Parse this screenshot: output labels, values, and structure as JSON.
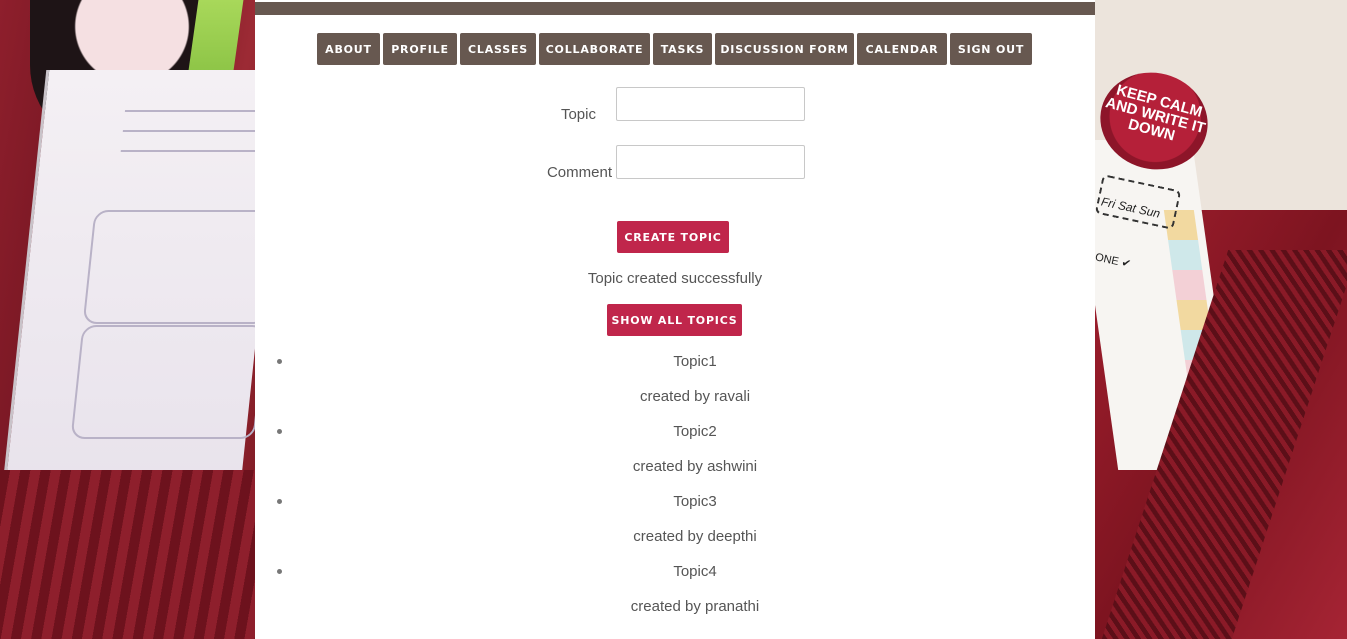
{
  "nav": {
    "items": [
      {
        "label": "ABOUT"
      },
      {
        "label": "PROFILE"
      },
      {
        "label": "CLASSES"
      },
      {
        "label": "COLLABORATE"
      },
      {
        "label": "TASKS"
      },
      {
        "label": "DISCUSSION FORM"
      },
      {
        "label": "CALENDAR"
      },
      {
        "label": "SIGN OUT"
      }
    ]
  },
  "form": {
    "topic_label": "Topic",
    "topic_value": "",
    "comment_label": "Comment",
    "comment_value": "",
    "create_button": "CREATE TOPIC"
  },
  "status": {
    "message": "Topic created successfully"
  },
  "show_all_button": "SHOW ALL TOPICS",
  "topics": [
    {
      "name": "Topic1",
      "author": "created by ravali"
    },
    {
      "name": "Topic2",
      "author": "created by ashwini"
    },
    {
      "name": "Topic3",
      "author": "created by deepthi"
    },
    {
      "name": "Topic4",
      "author": "created by pranathi"
    }
  ],
  "background": {
    "badge_text": "KEEP CALM AND WRITE IT DOWN",
    "days_text": "Fri Sat Sun",
    "done_text": "ONE"
  },
  "colors": {
    "nav_bg": "#675850",
    "accent": "#c0264b",
    "text": "#555555"
  }
}
